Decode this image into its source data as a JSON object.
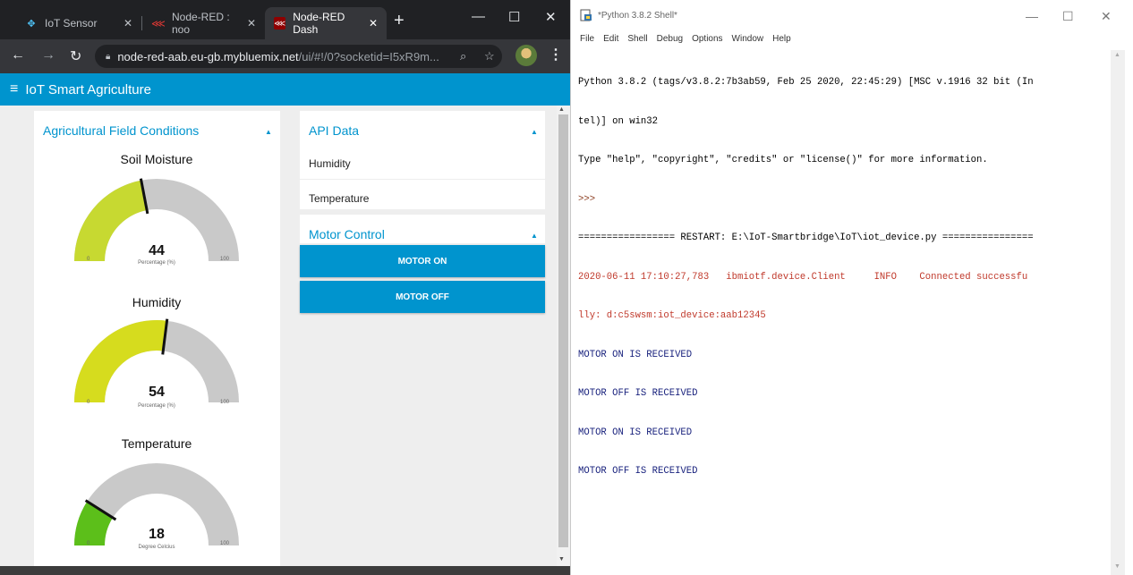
{
  "chrome": {
    "tabs": [
      {
        "title": "IoT Sensor",
        "active": false
      },
      {
        "title": "Node-RED : noo",
        "active": false
      },
      {
        "title": "Node-RED Dash",
        "active": true
      }
    ],
    "url_host": "node-red-aab.eu-gb.mybluemix.net",
    "url_path": "/ui/#!/0?socketid=I5xR9m..."
  },
  "dashboard": {
    "header_title": "IoT Smart Agriculture",
    "field_group_title": "Agricultural Field Conditions",
    "gauges": [
      {
        "title": "Soil Moisture",
        "value": "44",
        "unit": "Percentage (%)",
        "min": "0",
        "max": "100",
        "color": "#c7d931"
      },
      {
        "title": "Humidity",
        "value": "54",
        "unit": "Percentage (%)",
        "min": "0",
        "max": "100",
        "color": "#d6dc1e"
      },
      {
        "title": "Temperature",
        "value": "18",
        "unit": "Degree Celcius",
        "min": "0",
        "max": "100",
        "color": "#5cbf1a"
      }
    ],
    "api_group_title": "API Data",
    "api_rows": [
      "Humidity",
      "Temperature"
    ],
    "motor_group_title": "Motor Control",
    "motor_on_label": "MOTOR ON",
    "motor_off_label": "MOTOR OFF",
    "accent": "#0094ce"
  },
  "idle": {
    "window_title": "*Python 3.8.2 Shell*",
    "menu": [
      "File",
      "Edit",
      "Shell",
      "Debug",
      "Options",
      "Window",
      "Help"
    ],
    "lines": [
      {
        "text": "Python 3.8.2 (tags/v3.8.2:7b3ab59, Feb 25 2020, 22:45:29) [MSC v.1916 32 bit (In",
        "style": "plain"
      },
      {
        "text": "tel)] on win32",
        "style": "plain"
      },
      {
        "text": "Type \"help\", \"copyright\", \"credits\" or \"license()\" for more information.",
        "style": "plain"
      },
      {
        "text": ">>>",
        "style": "prompt"
      },
      {
        "text": "================= RESTART: E:\\IoT-Smartbridge\\IoT\\iot_device.py ================",
        "style": "plain"
      },
      {
        "text": "2020-06-11 17:10:27,783   ibmiotf.device.Client     INFO    Connected successfu",
        "style": "red"
      },
      {
        "text": "lly: d:c5swsm:iot_device:aab12345",
        "style": "red"
      },
      {
        "text": "MOTOR ON IS RECEIVED",
        "style": "blue"
      },
      {
        "text": "MOTOR OFF IS RECEIVED",
        "style": "blue"
      },
      {
        "text": "MOTOR ON IS RECEIVED",
        "style": "blue"
      },
      {
        "text": "MOTOR OFF IS RECEIVED",
        "style": "blue"
      }
    ]
  }
}
